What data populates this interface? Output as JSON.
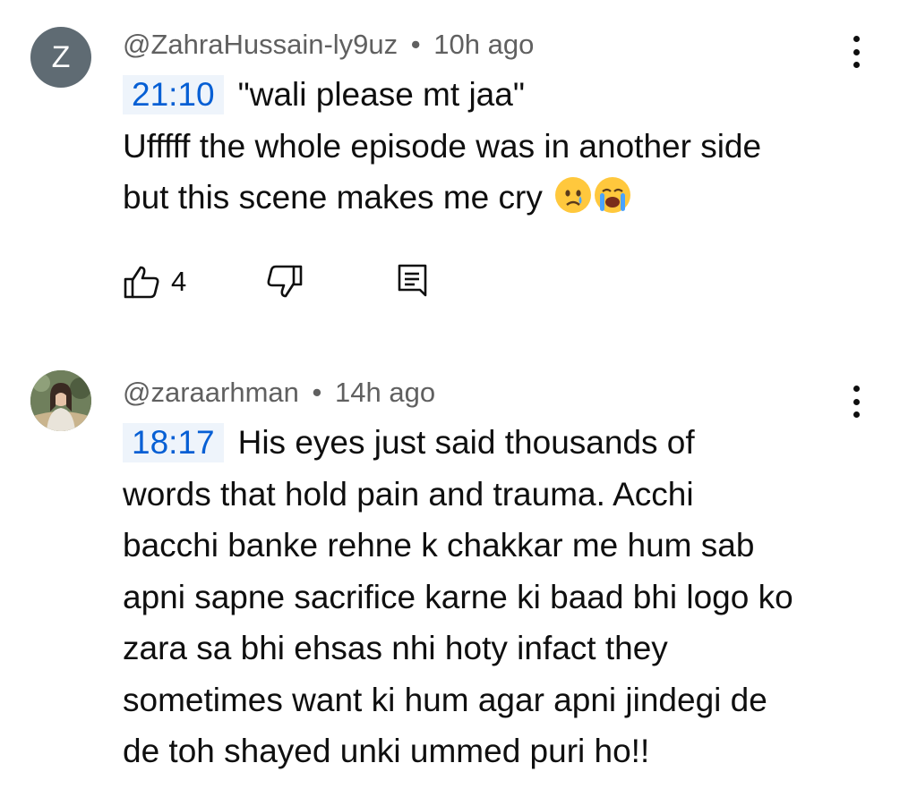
{
  "comments": [
    {
      "avatar_letter": "Z",
      "avatar_color": "#5f6b73",
      "handle": "@ZahraHussain-ly9uz",
      "separator": "•",
      "time_ago": "10h ago",
      "timestamp": "21:10",
      "lines": [
        "\"wali please mt jaa\"",
        "Ufffff the whole episode was in another side",
        "but this scene makes me cry"
      ],
      "emojis": [
        "crying-face-emoji",
        "loudly-crying-face-emoji"
      ],
      "likes": "4"
    },
    {
      "avatar_letter": "",
      "handle": "@zaraarhman",
      "separator": "•",
      "time_ago": "14h ago",
      "timestamp": "18:17",
      "lines": [
        "His eyes just said thousands of",
        "words that hold pain and trauma. Acchi",
        "bacchi banke rehne k chakkar me hum sab",
        "apni sapne sacrifice karne ki baad bhi logo ko",
        "zara sa bhi ehsas nhi hoty infact they",
        "sometimes want ki hum agar apni jindegi de",
        "de toh shayed unki ummed puri ho!!"
      ]
    }
  ],
  "icons": {
    "like": "thumbs-up-icon",
    "dislike": "thumbs-down-icon",
    "reply": "reply-icon",
    "menu": "more-vert-icon"
  },
  "colors": {
    "timestamp_text": "#065fd4",
    "timestamp_bg": "#eef4fb",
    "meta_text": "#606060"
  }
}
